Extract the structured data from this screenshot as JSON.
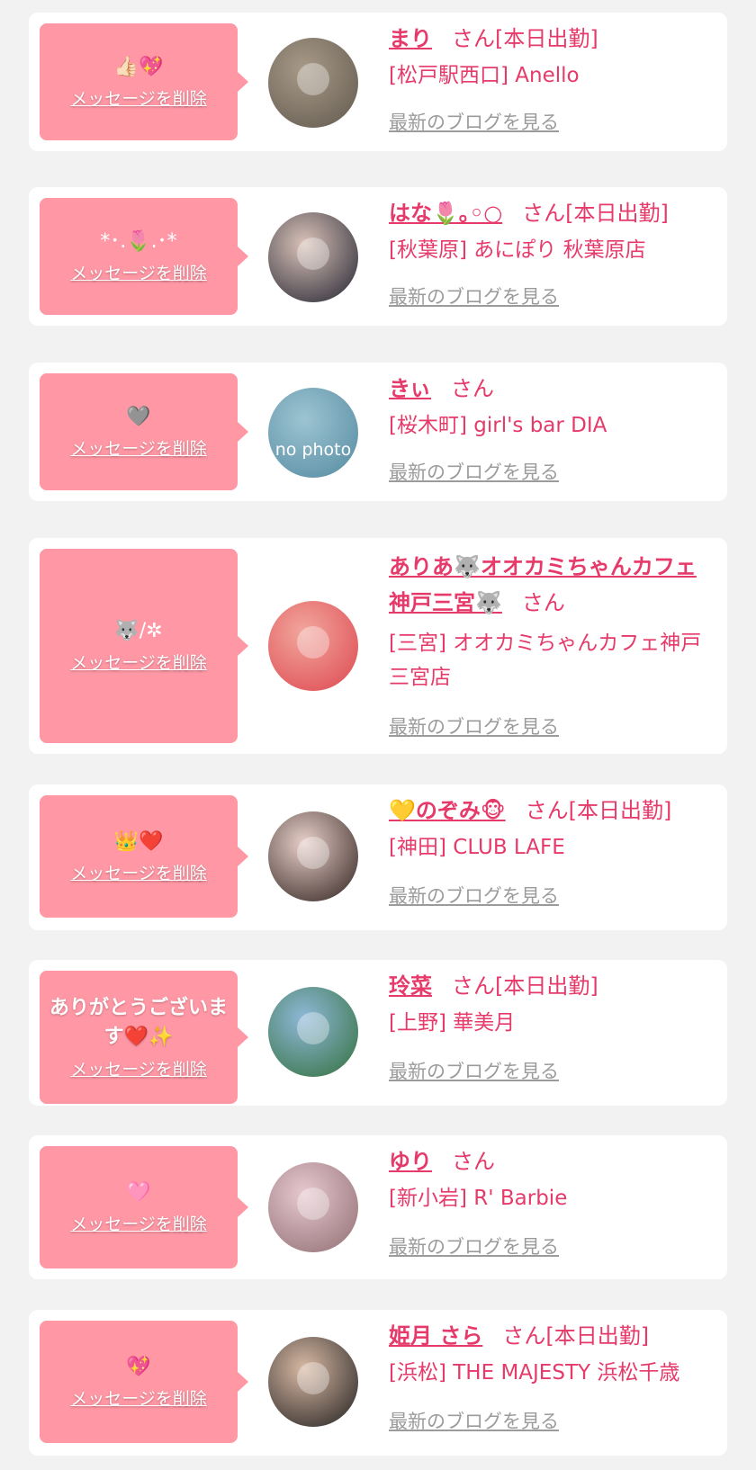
{
  "delete_label": "メッセージを削除",
  "blog_label": "最新のブログを見る",
  "items": [
    {
      "message": "👍🏻💖",
      "name": "まり",
      "suffix": "さん[本日出勤]",
      "shop": "[松戸駅西口] Anello",
      "avatar_colors": [
        "#6b6256",
        "#a89a88"
      ]
    },
    {
      "message": "*･.🌷.･*",
      "name": "はな🌷｡◦○",
      "suffix": "さん[本日出勤]",
      "shop": "[秋葉原] あにぽり 秋葉原店",
      "avatar_colors": [
        "#3d3a44",
        "#d9c2b8"
      ]
    },
    {
      "message": "🩶",
      "name": "きぃ",
      "suffix": "さん",
      "shop": "[桜木町] girl's bar DIA",
      "avatar_colors": [
        "#5f93a8",
        "#9dc4d2"
      ],
      "nophoto": "no photo"
    },
    {
      "message": "🐺/✲",
      "name": "ありあ🐺オオカミちゃんカフェ神戸三宮🐺",
      "suffix": "さん",
      "shop": "[三宮] オオカミちゃんカフェ神戸三宮店",
      "avatar_colors": [
        "#e0555b",
        "#f2a79d"
      ]
    },
    {
      "message": "👑❤️",
      "name": "💛のぞみ🐵",
      "suffix": "さん[本日出勤]",
      "shop": "[神田] CLUB LAFE",
      "avatar_colors": [
        "#4a3a36",
        "#e8cfc9"
      ]
    },
    {
      "message": "ありがとうございます❤️✨",
      "name": "玲菜",
      "suffix": "さん[本日出勤]",
      "shop": "[上野] 華美月",
      "avatar_colors": [
        "#3f7a52",
        "#8fb8d8"
      ],
      "text_message": true
    },
    {
      "message": "🩷",
      "name": "ゆり",
      "suffix": "さん",
      "shop": "[新小岩] R' Barbie",
      "avatar_colors": [
        "#9c7a80",
        "#e6c9cf"
      ]
    },
    {
      "message": "💖",
      "name": "姫月 さら",
      "suffix": "さん[本日出勤]",
      "shop": "[浜松] THE MAJESTY 浜松千歳",
      "avatar_colors": [
        "#3b3532",
        "#d8b9a4"
      ]
    }
  ]
}
